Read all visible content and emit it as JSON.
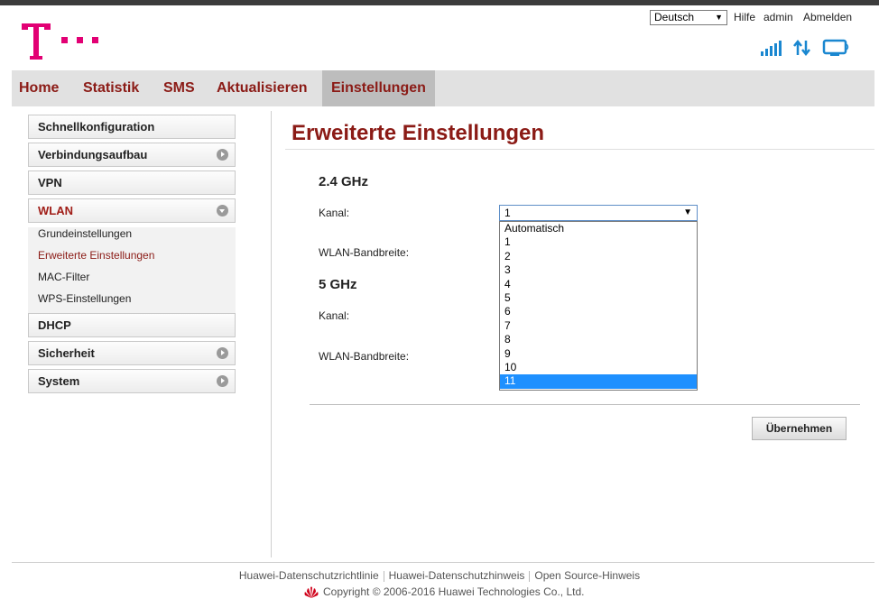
{
  "header": {
    "language": "Deutsch",
    "help_label": "Hilfe",
    "user_label": "admin",
    "logout_label": "Abmelden",
    "brand_color": "#e20074"
  },
  "nav": {
    "items": [
      {
        "label": "Home"
      },
      {
        "label": "Statistik"
      },
      {
        "label": "SMS"
      },
      {
        "label": "Aktualisieren"
      },
      {
        "label": "Einstellungen",
        "active": true
      }
    ]
  },
  "sidebar": {
    "items": [
      {
        "label": "Schnellkonfiguration"
      },
      {
        "label": "Verbindungsaufbau"
      },
      {
        "label": "VPN"
      },
      {
        "label": "WLAN",
        "active": true
      },
      {
        "label": "DHCP"
      },
      {
        "label": "Sicherheit"
      },
      {
        "label": "System"
      }
    ],
    "wlan_sub": [
      {
        "label": "Grundeinstellungen"
      },
      {
        "label": "Erweiterte Einstellungen",
        "active": true
      },
      {
        "label": "MAC-Filter"
      },
      {
        "label": "WPS-Einstellungen"
      }
    ]
  },
  "main": {
    "title": "Erweiterte Einstellungen",
    "band24": {
      "heading": "2.4 GHz",
      "channel_label": "Kanal:",
      "channel_value": "1",
      "bandwidth_label": "WLAN-Bandbreite:"
    },
    "band5": {
      "heading": "5 GHz",
      "channel_label": "Kanal:",
      "bandwidth_label": "WLAN-Bandbreite:"
    },
    "channel_options": [
      "Automatisch",
      "1",
      "2",
      "3",
      "4",
      "5",
      "6",
      "7",
      "8",
      "9",
      "10",
      "11"
    ],
    "highlighted_option": "11",
    "apply_label": "Übernehmen"
  },
  "footer": {
    "links": [
      "Huawei-Datenschutzrichtlinie",
      "Huawei-Datenschutzhinweis",
      "Open Source-Hinweis"
    ],
    "copyright": "Copyright © 2006-2016 Huawei Technologies Co., Ltd."
  },
  "colors": {
    "accent": "#8b1b16",
    "status_icon": "#1a87d0",
    "dropdown_highlight": "#1e90ff"
  }
}
